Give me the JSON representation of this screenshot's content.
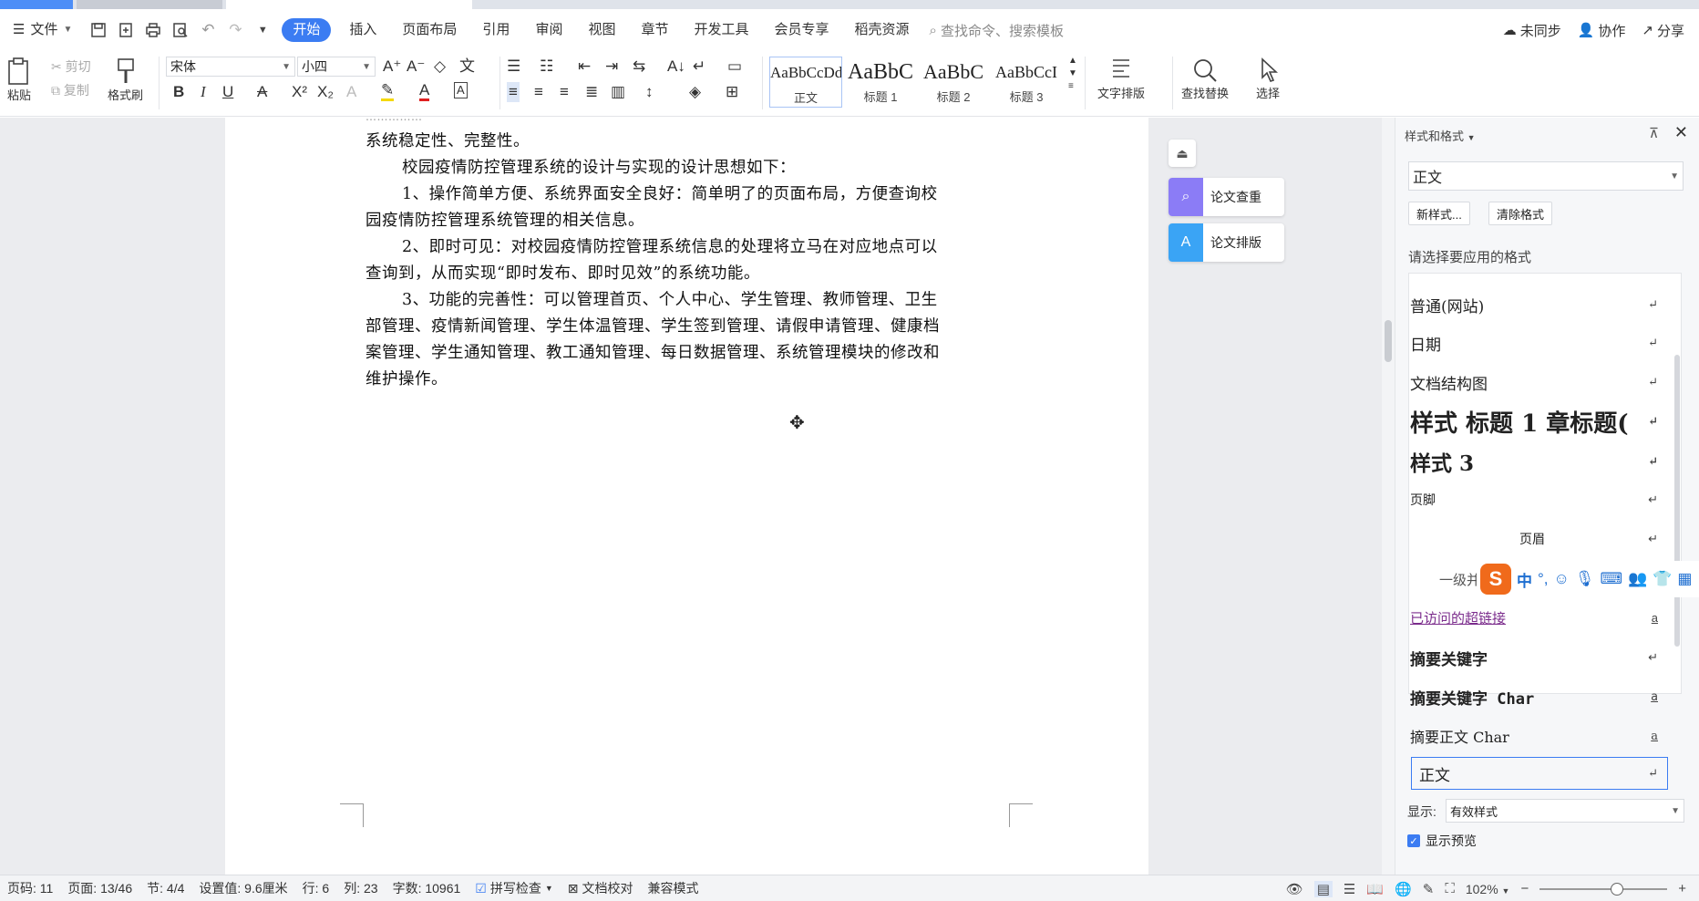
{
  "menubar": {
    "file_label": "文件",
    "tabs": [
      "开始",
      "插入",
      "页面布局",
      "引用",
      "审阅",
      "视图",
      "章节",
      "开发工具",
      "会员专享",
      "稻壳资源"
    ],
    "active_tab": "开始",
    "search_placeholder": "查找命令、搜索模板",
    "sync": "未同步",
    "collab": "协作",
    "share": "分享"
  },
  "ribbon": {
    "paste": "粘贴",
    "cut": "剪切",
    "copy": "复制",
    "format_painter": "格式刷",
    "font_name": "宋体",
    "font_size": "小四",
    "styles": [
      {
        "preview": "AaBbCcDd",
        "label": "正文"
      },
      {
        "preview": "AaBbC",
        "label": "标题 1"
      },
      {
        "preview": "AaBbC",
        "label": "标题 2"
      },
      {
        "preview": "AaBbCcI",
        "label": "标题 3"
      }
    ],
    "text_layout": "文字排版",
    "find_replace": "查找替换",
    "select": "选择"
  },
  "document": {
    "lines": [
      "系统稳定性、完整性。",
      "校园疫情防控管理系统的设计与实现的设计思想如下：",
      "1、操作简单方便、系统界面安全良好：简单明了的页面布局，方便查询校",
      "园疫情防控管理系统管理的相关信息。",
      "2、即时可见：对校园疫情防控管理系统信息的处理将立马在对应地点可以",
      "查询到，从而实现“即时发布、即时见效”的系统功能。",
      "3、功能的完善性：可以管理首页、个人中心、学生管理、教师管理、卫生",
      "部管理、疫情新闻管理、学生体温管理、学生签到管理、请假申请管理、健康档",
      "案管理、学生通知管理、教工通知管理、每日数据管理、系统管理模块的修改和",
      "维护操作。"
    ]
  },
  "sidebar": {
    "check": "论文查重",
    "layout": "论文排版"
  },
  "panel": {
    "title": "样式和格式",
    "current_style": "正文",
    "new_style": "新样式...",
    "clear_format": "清除格式",
    "prompt": "请选择要应用的格式",
    "items": [
      "普通(网站)",
      "日期",
      "文档结构图",
      "样式 标题 1 章标题(",
      "样式 3",
      "页脚",
      "页眉",
      "一级并",
      "已访问的超链接",
      "摘要关键字",
      "摘要关键字 Char",
      "摘要正文 Char",
      "正文"
    ],
    "show_label": "显示:",
    "show_value": "有效样式",
    "preview_label": "显示预览"
  },
  "ime": {
    "lang": "中"
  },
  "status": {
    "page_no": "页码: 11",
    "page": "页面: 13/46",
    "section": "节: 4/4",
    "setting": "设置值: 9.6厘米",
    "row": "行: 6",
    "col": "列: 23",
    "words": "字数: 10961",
    "spell": "拼写检查",
    "proof": "文档校对",
    "compat": "兼容模式",
    "zoom": "102%"
  }
}
